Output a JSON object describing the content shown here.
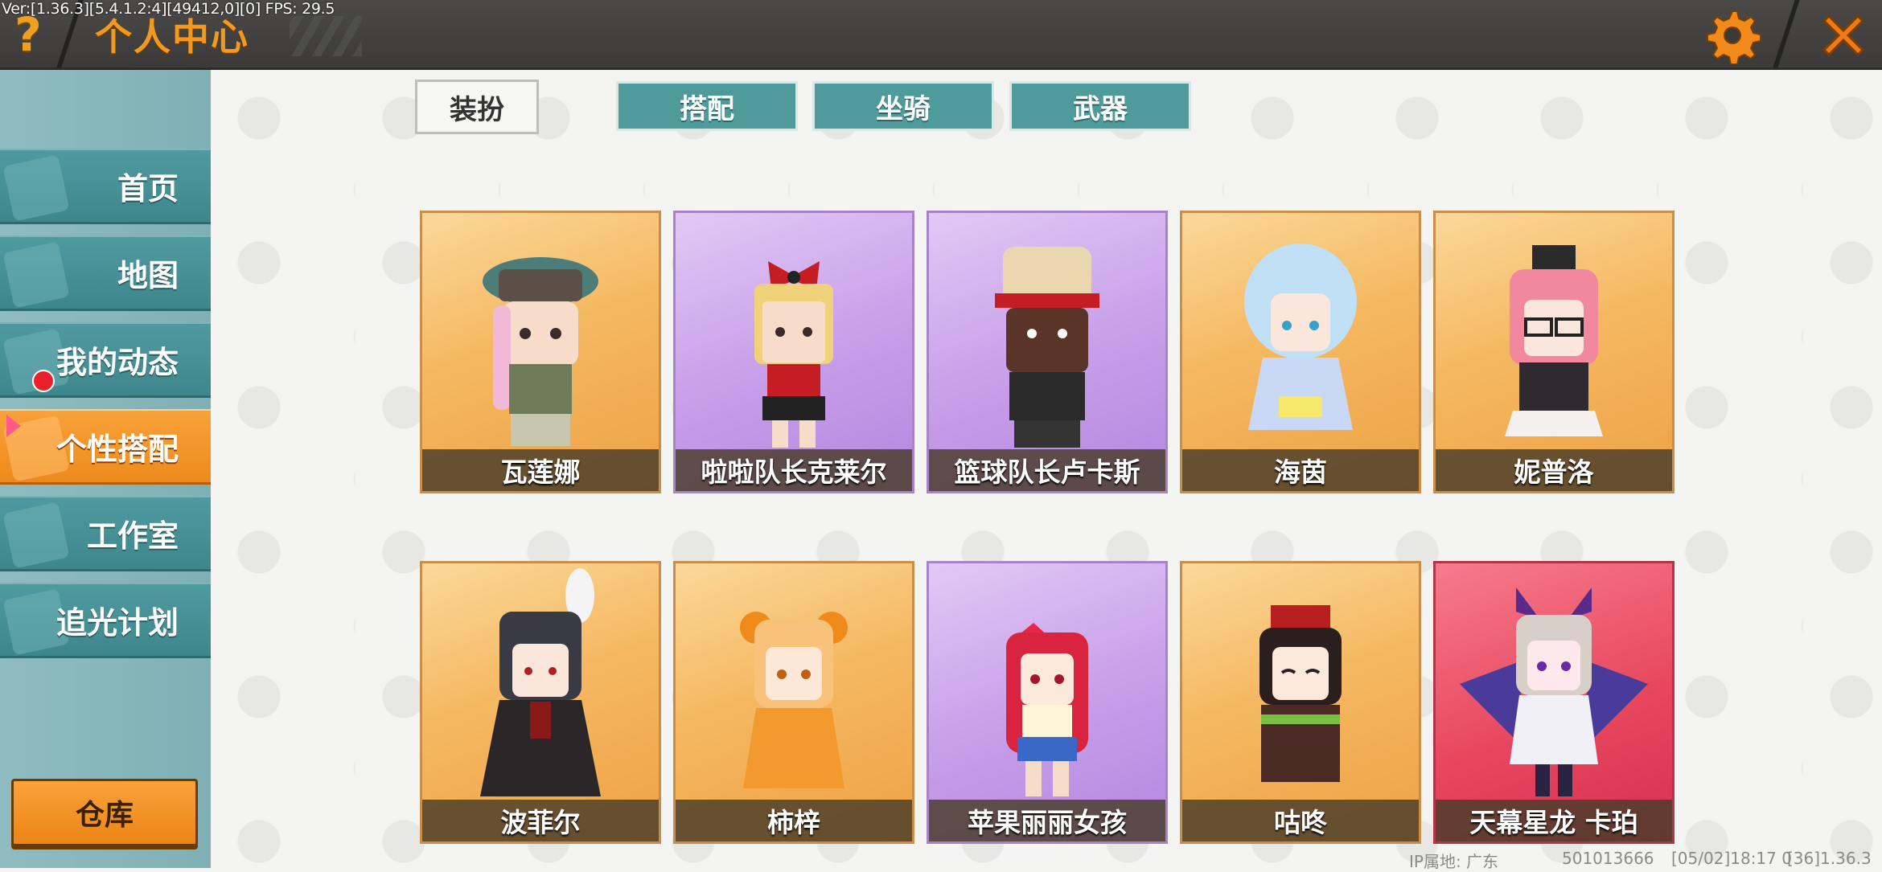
{
  "debug_text": "Ver:[1.36.3][5.4.1.2:4][49412,0][0] FPS: 29.5",
  "header": {
    "help_icon": "question-mark-icon",
    "title": "个人中心",
    "settings_icon": "gear-icon",
    "close_icon": "close-x-icon"
  },
  "colors": {
    "accent_orange": "#f39a1e",
    "teal_tab": "#4f9a9b",
    "sidebar_teal": "#3d868c"
  },
  "sidebar": {
    "items": [
      {
        "label": "首页",
        "icon": "home-icon"
      },
      {
        "label": "地图",
        "icon": "map-icon"
      },
      {
        "label": "我的动态",
        "icon": "feed-icon",
        "has_badge": true
      },
      {
        "label": "个性搭配",
        "icon": "hanger-icon",
        "active": true
      },
      {
        "label": "工作室",
        "icon": "studio-icon"
      },
      {
        "label": "追光计划",
        "icon": "plan-icon"
      }
    ],
    "warehouse_label": "仓库"
  },
  "tabs": [
    {
      "label": "装扮",
      "active": true
    },
    {
      "label": "搭配"
    },
    {
      "label": "坐骑"
    },
    {
      "label": "武器"
    }
  ],
  "skins": [
    {
      "name": "瓦莲娜",
      "rarity": "orange"
    },
    {
      "name": "啦啦队长克莱尔",
      "rarity": "purple"
    },
    {
      "name": "篮球队长卢卡斯",
      "rarity": "purple"
    },
    {
      "name": "海茵",
      "rarity": "orange"
    },
    {
      "name": "妮普洛",
      "rarity": "orange"
    },
    {
      "name": "波菲尔",
      "rarity": "orange"
    },
    {
      "name": "柿梓",
      "rarity": "orange"
    },
    {
      "name": "苹果丽丽女孩",
      "rarity": "purple"
    },
    {
      "name": "咕咚",
      "rarity": "orange"
    },
    {
      "name": "天幕星龙 卡珀",
      "rarity": "red"
    }
  ],
  "footer": {
    "ip_location": "IP属地: 广东",
    "uid": "501013666",
    "timestamp": "[05/02]18:17 0",
    "version": "[36]1.36.3"
  }
}
